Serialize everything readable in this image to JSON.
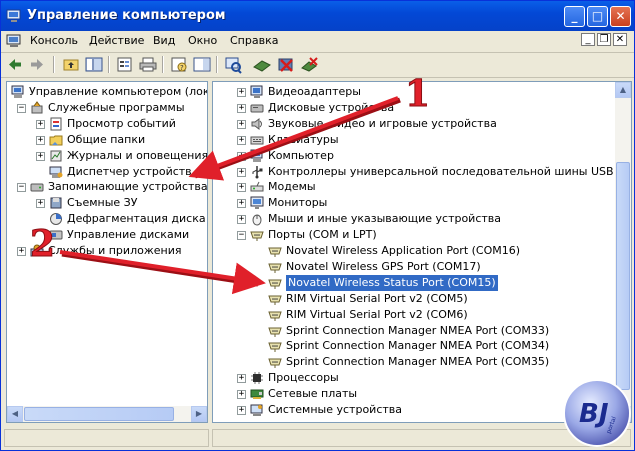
{
  "window": {
    "title": "Управление компьютером",
    "minimize": "_",
    "maximize": "□",
    "close": "✕"
  },
  "menu": {
    "items": [
      "Консоль",
      "Действие",
      "Вид",
      "Окно",
      "Справка"
    ],
    "mdi_min": "_",
    "mdi_restore": "❐",
    "mdi_close": "✕"
  },
  "left_tree": [
    {
      "label": "Управление компьютером (локаль",
      "level": 0,
      "expander": "",
      "icon": "computer-icon"
    },
    {
      "label": "Служебные программы",
      "level": 1,
      "expander": "−",
      "icon": "tools-icon"
    },
    {
      "label": "Просмотр событий",
      "level": 2,
      "expander": "+",
      "icon": "event-viewer-icon"
    },
    {
      "label": "Общие папки",
      "level": 2,
      "expander": "+",
      "icon": "shared-folder-icon"
    },
    {
      "label": "Журналы и оповещения п",
      "level": 2,
      "expander": "+",
      "icon": "logs-icon"
    },
    {
      "label": "Диспетчер устройств",
      "level": 2,
      "expander": "",
      "icon": "device-manager-icon"
    },
    {
      "label": "Запоминающие устройства",
      "level": 1,
      "expander": "−",
      "icon": "storage-icon"
    },
    {
      "label": "Съемные ЗУ",
      "level": 2,
      "expander": "+",
      "icon": "removable-storage-icon"
    },
    {
      "label": "Дефрагментация диска",
      "level": 2,
      "expander": "",
      "icon": "defrag-icon"
    },
    {
      "label": "Управление дисками",
      "level": 2,
      "expander": "",
      "icon": "disk-management-icon"
    },
    {
      "label": "Службы и приложения",
      "level": 1,
      "expander": "+",
      "icon": "services-icon"
    }
  ],
  "right_tree": [
    {
      "label": "Видеоадаптеры",
      "level": 0,
      "expander": "+",
      "icon": "display-adapter-icon"
    },
    {
      "label": "Дисковые устройства",
      "level": 0,
      "expander": "+",
      "icon": "disk-drive-icon"
    },
    {
      "label": "Звуковые, видео и игровые устройства",
      "level": 0,
      "expander": "+",
      "icon": "sound-icon"
    },
    {
      "label": "Клавиатуры",
      "level": 0,
      "expander": "+",
      "icon": "keyboard-icon"
    },
    {
      "label": "Компьютер",
      "level": 0,
      "expander": "+",
      "icon": "computer-icon"
    },
    {
      "label": "Контроллеры универсальной последовательной шины USB",
      "level": 0,
      "expander": "+",
      "icon": "usb-icon"
    },
    {
      "label": "Модемы",
      "level": 0,
      "expander": "+",
      "icon": "modem-icon"
    },
    {
      "label": "Мониторы",
      "level": 0,
      "expander": "+",
      "icon": "monitor-icon"
    },
    {
      "label": "Мыши и иные указывающие устройства",
      "level": 0,
      "expander": "+",
      "icon": "mouse-icon"
    },
    {
      "label": "Порты (COM и LPT)",
      "level": 0,
      "expander": "−",
      "icon": "port-icon"
    },
    {
      "label": "Novatel Wireless Application Port (COM16)",
      "level": 1,
      "expander": "",
      "icon": "port-icon"
    },
    {
      "label": "Novatel Wireless GPS Port (COM17)",
      "level": 1,
      "expander": "",
      "icon": "port-icon"
    },
    {
      "label": "Novatel Wireless Status Port (COM15)",
      "level": 1,
      "expander": "",
      "icon": "port-icon",
      "selected": true
    },
    {
      "label": "RIM Virtual Serial Port v2 (COM5)",
      "level": 1,
      "expander": "",
      "icon": "port-icon"
    },
    {
      "label": "RIM Virtual Serial Port v2 (COM6)",
      "level": 1,
      "expander": "",
      "icon": "port-icon"
    },
    {
      "label": "Sprint Connection Manager NMEA Port (COM33)",
      "level": 1,
      "expander": "",
      "icon": "port-icon"
    },
    {
      "label": "Sprint Connection Manager NMEA Port (COM34)",
      "level": 1,
      "expander": "",
      "icon": "port-icon"
    },
    {
      "label": "Sprint Connection Manager NMEA Port (COM35)",
      "level": 1,
      "expander": "",
      "icon": "port-icon"
    },
    {
      "label": "Процессоры",
      "level": 0,
      "expander": "+",
      "icon": "processor-icon"
    },
    {
      "label": "Сетевые платы",
      "level": 0,
      "expander": "+",
      "icon": "network-card-icon"
    },
    {
      "label": "Системные устройства",
      "level": 0,
      "expander": "+",
      "icon": "system-devices-icon"
    }
  ],
  "annotations": {
    "marker_1": "1",
    "marker_2": "2",
    "arrow_color": "#e0202a"
  },
  "watermark": {
    "text": "BJ",
    "subtext": "portal"
  },
  "colors": {
    "title_bar": "#0348d6",
    "selection": "#316ac5",
    "window_face": "#ece9d8"
  }
}
